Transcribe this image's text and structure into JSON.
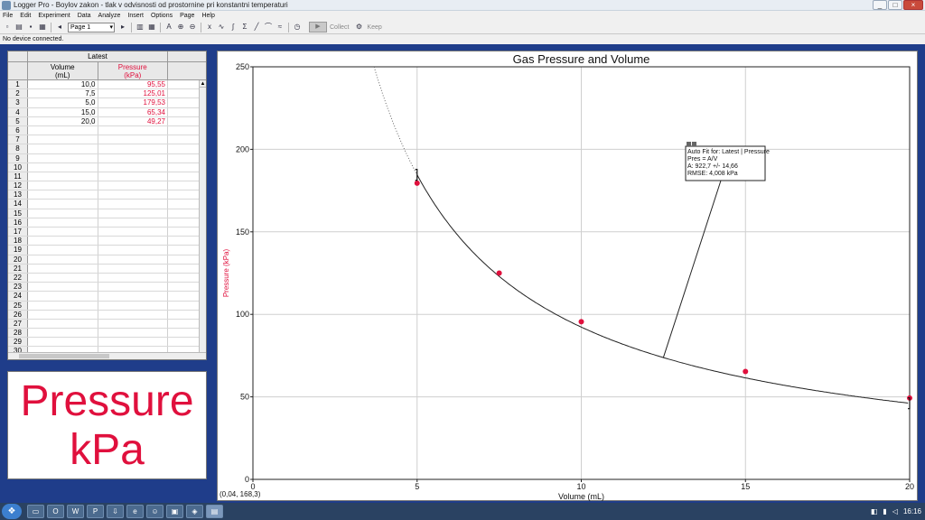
{
  "window": {
    "title": "Logger Pro - Boylov zakon - tlak v odvisnosti od prostornine pri konstantni temperaturi",
    "buttons": [
      "_",
      "□",
      "×"
    ]
  },
  "menu": [
    "File",
    "Edit",
    "Experiment",
    "Data",
    "Analyze",
    "Insert",
    "Options",
    "Page",
    "Help"
  ],
  "toolbar": {
    "page_select": "Page 1",
    "collect_label": "Collect",
    "keep_label": "Keep"
  },
  "status": "No device connected.",
  "table": {
    "group_header": "Latest",
    "columns": [
      {
        "name": "Volume",
        "unit": "(mL)"
      },
      {
        "name": "Pressure",
        "unit": "(kPa)"
      }
    ],
    "rows": [
      [
        "10,0",
        "95,55"
      ],
      [
        "7,5",
        "125,01"
      ],
      [
        "5,0",
        "179,53"
      ],
      [
        "15,0",
        "65,34"
      ],
      [
        "20,0",
        "49,27"
      ]
    ],
    "row_count": 30
  },
  "meter": {
    "line1": "Pressure",
    "line2": "kPa",
    "color": "#e0103d"
  },
  "readout": "(0,04, 168,3)",
  "chart_data": {
    "type": "scatter",
    "title": "Gas Pressure and Volume",
    "xlabel": "Volume (mL)",
    "ylabel": "Pressure (kPa)",
    "xlim": [
      0,
      20
    ],
    "ylim": [
      0,
      250
    ],
    "x_ticks": [
      0,
      5,
      10,
      15,
      20
    ],
    "y_ticks": [
      0,
      50,
      100,
      150,
      200,
      250
    ],
    "grid": true,
    "series": [
      {
        "x": [
          10.0,
          7.5,
          5.0,
          15.0,
          20.0
        ],
        "y": [
          95.55,
          125.01,
          179.53,
          65.34,
          49.27
        ],
        "color": "#e0103d"
      }
    ],
    "fit": {
      "A": 922.7,
      "lines": [
        "Auto Fit for: Latest | Pressure",
        "Pres = A/V",
        "A: 922,7 +/- 14,66",
        "RMSE: 4,008 kPa"
      ]
    }
  }
}
